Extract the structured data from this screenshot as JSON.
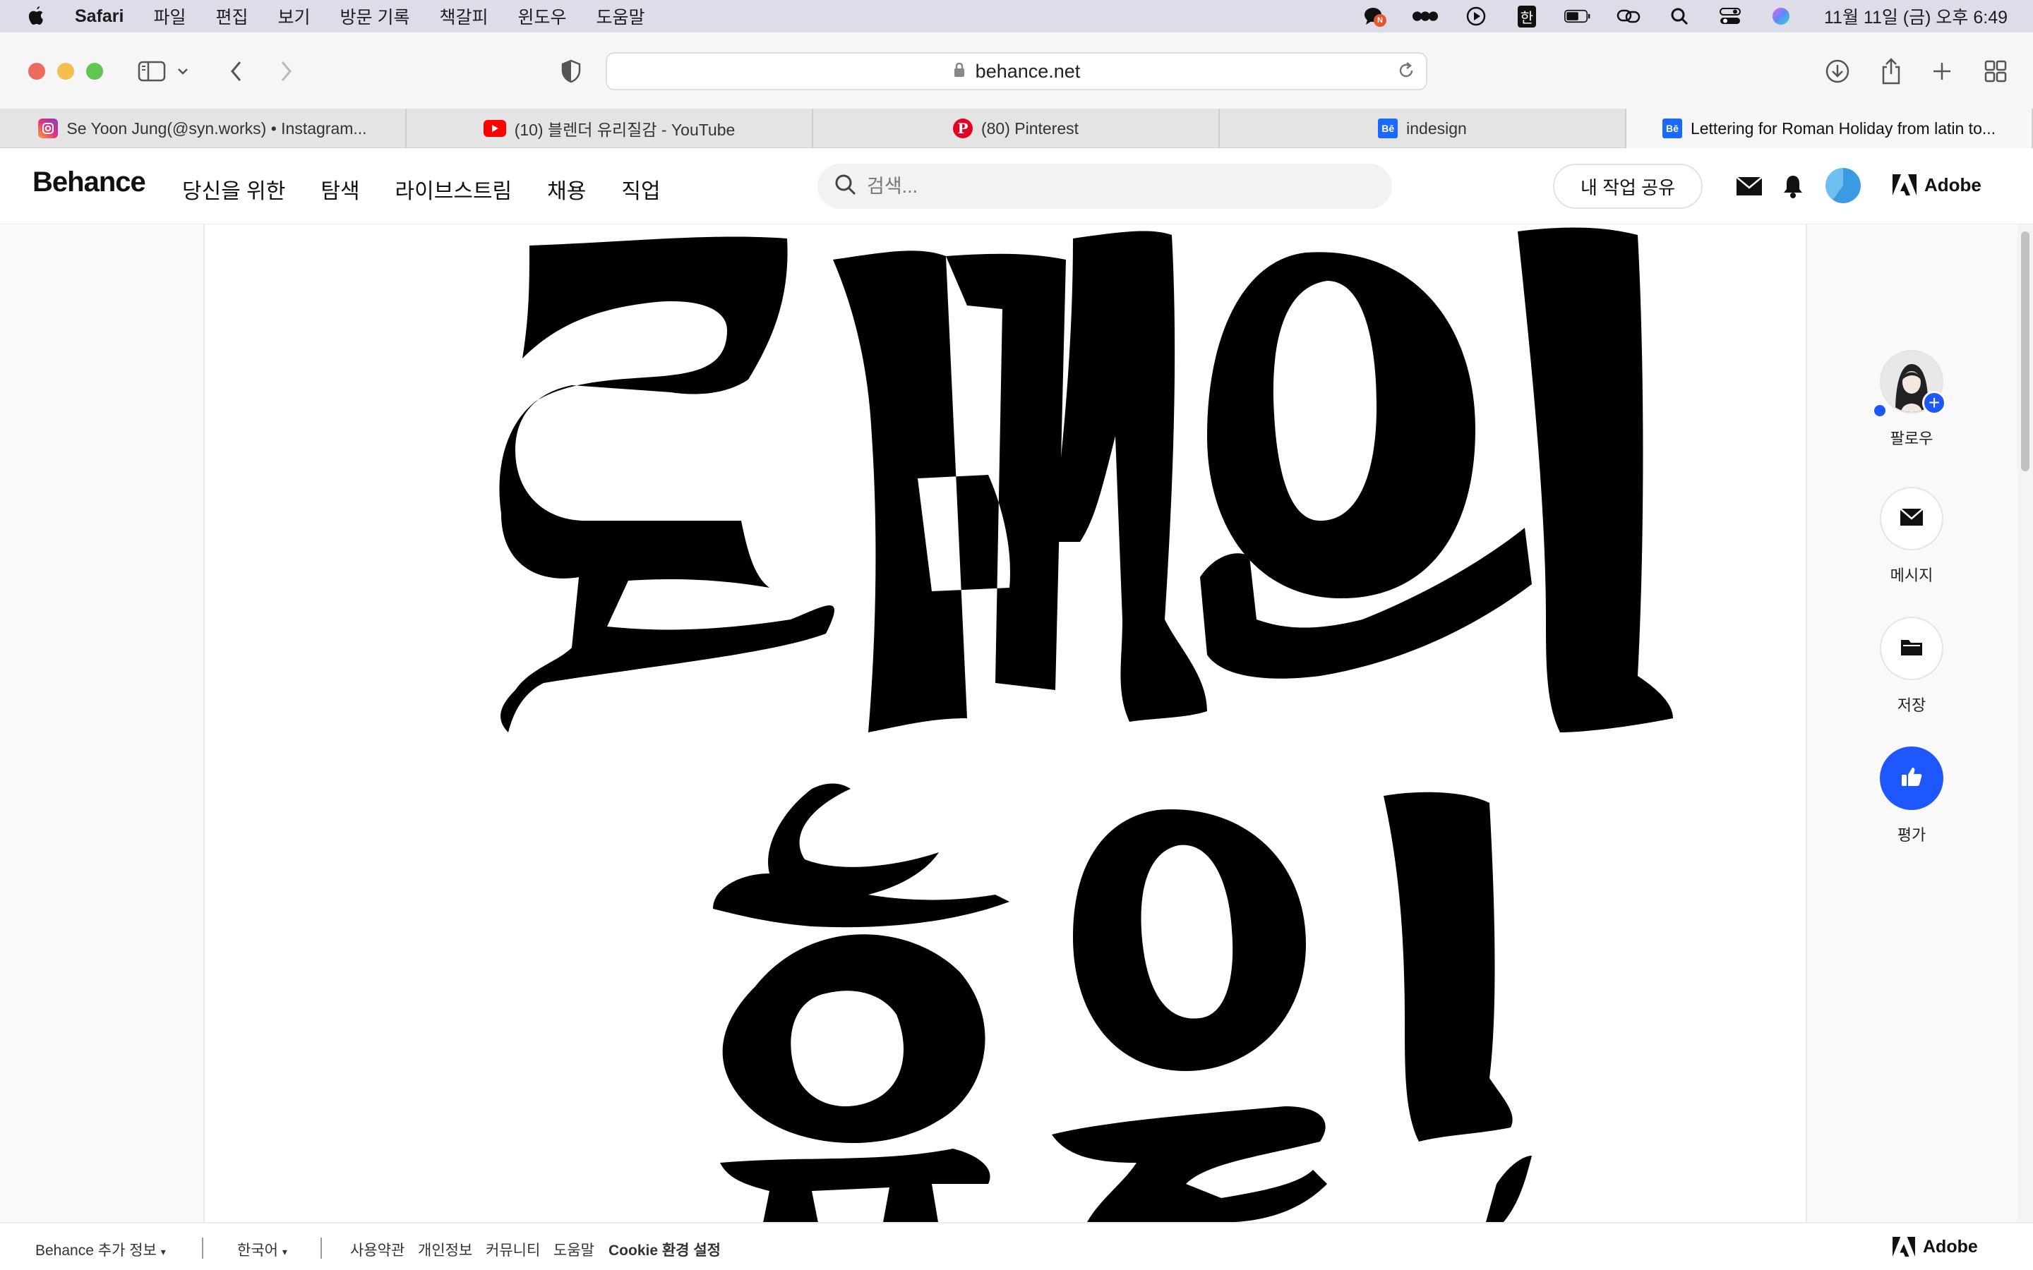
{
  "menubar": {
    "app_name": "Safari",
    "items": [
      "파일",
      "편집",
      "보기",
      "방문 기록",
      "책갈피",
      "윈도우",
      "도움말"
    ],
    "input_mode": "한",
    "clock": "11월 11일 (금) 오후 6:49",
    "notification_badge": "N"
  },
  "toolbar": {
    "url": "behance.net"
  },
  "tabs": [
    {
      "title": "Se Yoon Jung(@syn.works) • Instagram...",
      "favicon": "instagram-icon",
      "active": false
    },
    {
      "title": "(10) 블렌더 유리질감 - YouTube",
      "favicon": "youtube-icon",
      "active": false
    },
    {
      "title": "(80) Pinterest",
      "favicon": "pinterest-icon",
      "active": false
    },
    {
      "title": "indesign",
      "favicon": "behance-icon",
      "active": false
    },
    {
      "title": "Lettering for Roman Holiday from latin to...",
      "favicon": "behance-icon",
      "active": true
    }
  ],
  "behance": {
    "logo": "Behance",
    "nav": [
      "당신을 위한",
      "탐색",
      "라이브스트림",
      "채용",
      "직업"
    ],
    "search_placeholder": "검색...",
    "share_button": "내 작업 공유",
    "adobe_label": "Adobe"
  },
  "side_actions": {
    "follow": "팔로우",
    "message": "메시지",
    "save": "저장",
    "appreciate": "평가"
  },
  "artwork": {
    "line1": "로마의",
    "line2": "휴일"
  },
  "footer": {
    "more_info": "Behance 추가 정보",
    "language": "한국어",
    "links": [
      "사용약관",
      "개인정보",
      "커뮤니티",
      "도움말",
      "Cookie 환경 설정"
    ],
    "adobe_label": "Adobe"
  },
  "colors": {
    "accent": "#1f57ff",
    "menubar_bg": "#dcdde8"
  }
}
